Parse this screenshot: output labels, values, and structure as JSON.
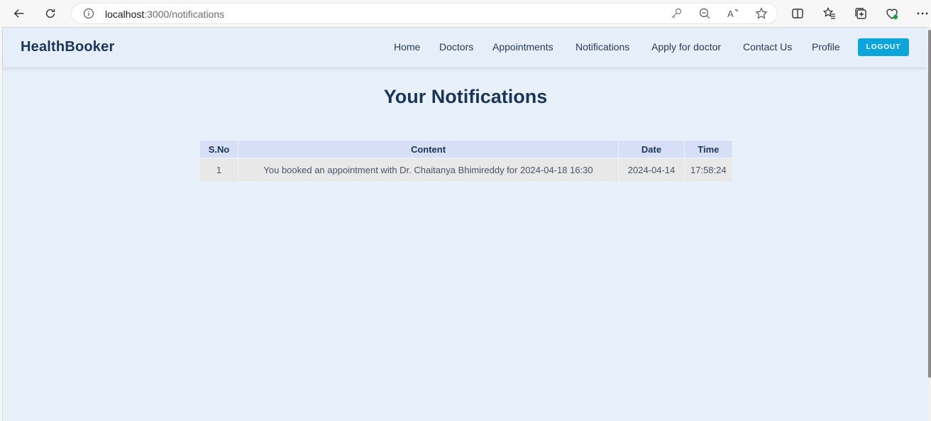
{
  "browser": {
    "url_host": "localhost",
    "url_path": ":3000/notifications",
    "icons": [
      "back-icon",
      "refresh-icon",
      "info-icon",
      "key-icon",
      "zoom-out-icon",
      "read-aloud-icon",
      "favorite-star-icon",
      "split-screen-icon",
      "favorites-icon",
      "collections-icon",
      "browser-essentials-icon",
      "more-icon"
    ]
  },
  "header": {
    "brand": "HealthBooker",
    "nav": [
      "Home",
      "Doctors",
      "Appointments",
      "Notifications",
      "Apply for doctor",
      "Contact Us",
      "Profile"
    ],
    "logout_label": "LOGOUT"
  },
  "main": {
    "title": "Your Notifications",
    "table": {
      "headers": [
        "S.No",
        "Content",
        "Date",
        "Time"
      ],
      "rows": [
        [
          "1",
          "You booked an appointment with Dr. Chaitanya Bhimireddy for 2024-04-18 16:30",
          "2024-04-14",
          "17:58:24"
        ]
      ]
    }
  },
  "colors": {
    "brand_text": "#1b3559",
    "logout_bg": "#0ba5dc",
    "page_bg": "#e8f0fa",
    "table_header_bg": "#d6dff5"
  }
}
